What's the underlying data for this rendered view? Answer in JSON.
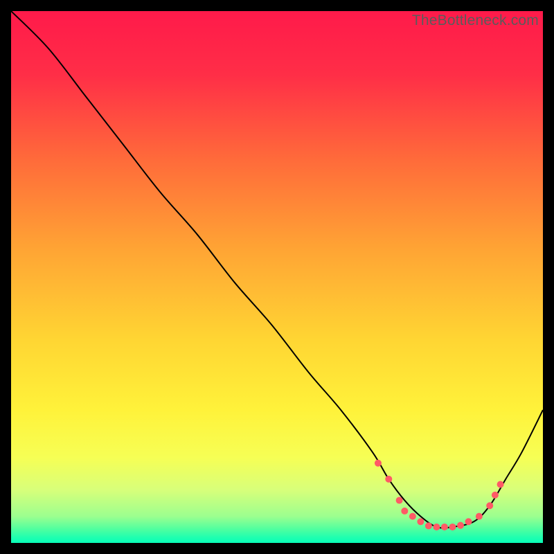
{
  "watermark": "TheBottleneck.com",
  "chart_data": {
    "type": "line",
    "title": "",
    "xlabel": "",
    "ylabel": "",
    "xlim": [
      0,
      100
    ],
    "ylim": [
      0,
      100
    ],
    "grid": false,
    "legend": false,
    "background_gradient_stops": [
      {
        "pct": 0.0,
        "color": "#ff1a4a"
      },
      {
        "pct": 0.12,
        "color": "#ff2e47"
      },
      {
        "pct": 0.28,
        "color": "#ff6b3a"
      },
      {
        "pct": 0.45,
        "color": "#ffa534"
      },
      {
        "pct": 0.62,
        "color": "#ffd633"
      },
      {
        "pct": 0.75,
        "color": "#fff23a"
      },
      {
        "pct": 0.84,
        "color": "#f6ff55"
      },
      {
        "pct": 0.9,
        "color": "#d8ff7a"
      },
      {
        "pct": 0.95,
        "color": "#9cff8f"
      },
      {
        "pct": 0.975,
        "color": "#4dffa0"
      },
      {
        "pct": 0.99,
        "color": "#1effb0"
      },
      {
        "pct": 1.0,
        "color": "#08ffb8"
      }
    ],
    "series": [
      {
        "name": "bottleneck-curve",
        "x": [
          0,
          7,
          14,
          21,
          28,
          35,
          42,
          49,
          56,
          62,
          68,
          71,
          74,
          77,
          80,
          83,
          87,
          90,
          93,
          96,
          100
        ],
        "y": [
          100,
          93,
          84,
          75,
          66,
          58,
          49,
          41,
          32,
          25,
          17,
          12,
          8,
          5,
          3,
          3,
          4,
          7,
          12,
          17,
          25
        ],
        "stroke": "#000000",
        "stroke_width": 2,
        "markers": false
      }
    ],
    "highlight_points": {
      "name": "optimal-zone-markers",
      "color": "#ff5a66",
      "radius": 5,
      "points": [
        {
          "x": 69,
          "y": 15
        },
        {
          "x": 71,
          "y": 12
        },
        {
          "x": 73,
          "y": 8
        },
        {
          "x": 74,
          "y": 6
        },
        {
          "x": 75.5,
          "y": 5
        },
        {
          "x": 77,
          "y": 4
        },
        {
          "x": 78.5,
          "y": 3.2
        },
        {
          "x": 80,
          "y": 3
        },
        {
          "x": 81.5,
          "y": 3
        },
        {
          "x": 83,
          "y": 3
        },
        {
          "x": 84.5,
          "y": 3.3
        },
        {
          "x": 86,
          "y": 4
        },
        {
          "x": 88,
          "y": 5
        },
        {
          "x": 90,
          "y": 7
        },
        {
          "x": 91,
          "y": 9
        },
        {
          "x": 92,
          "y": 11
        }
      ]
    }
  }
}
